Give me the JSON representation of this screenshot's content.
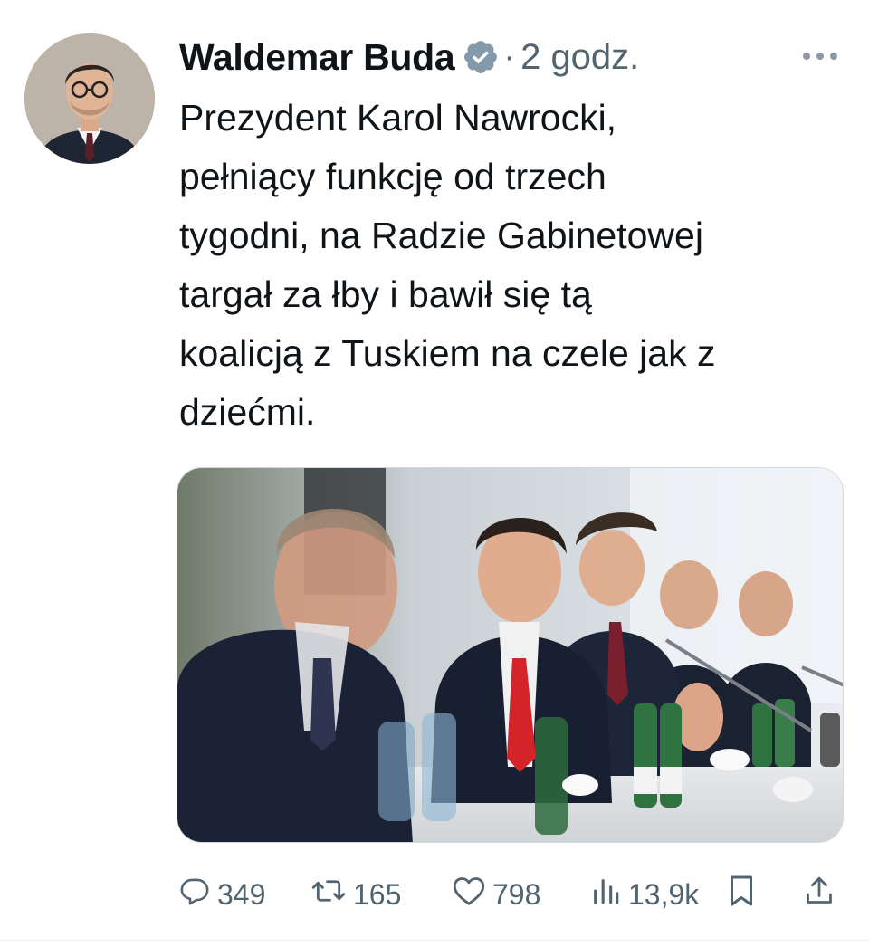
{
  "author": {
    "name": "Waldemar Buda",
    "verified": true,
    "time": "2 godz."
  },
  "tweet": {
    "text": "Prezydent Karol Nawrocki,\npełniący funkcję od trzech\ntygodni, na Radzie Gabinetowej\ntargał za łby i bawił się tą\nkoalicją z Tuskiem na czele jak z\ndziećmi."
  },
  "header": {
    "separator": "·"
  },
  "actions": {
    "replies": "349",
    "retweets": "165",
    "likes": "798",
    "views": "13,9k"
  },
  "icons": {
    "verified": "verified-badge-icon",
    "more": "more-options-icon",
    "reply": "reply-icon",
    "retweet": "retweet-icon",
    "like": "heart-icon",
    "views": "views-bar-chart-icon",
    "bookmark": "bookmark-icon",
    "share": "share-icon"
  },
  "colors": {
    "text": "#0f1419",
    "secondary": "#536471",
    "border": "#cfd9de"
  }
}
